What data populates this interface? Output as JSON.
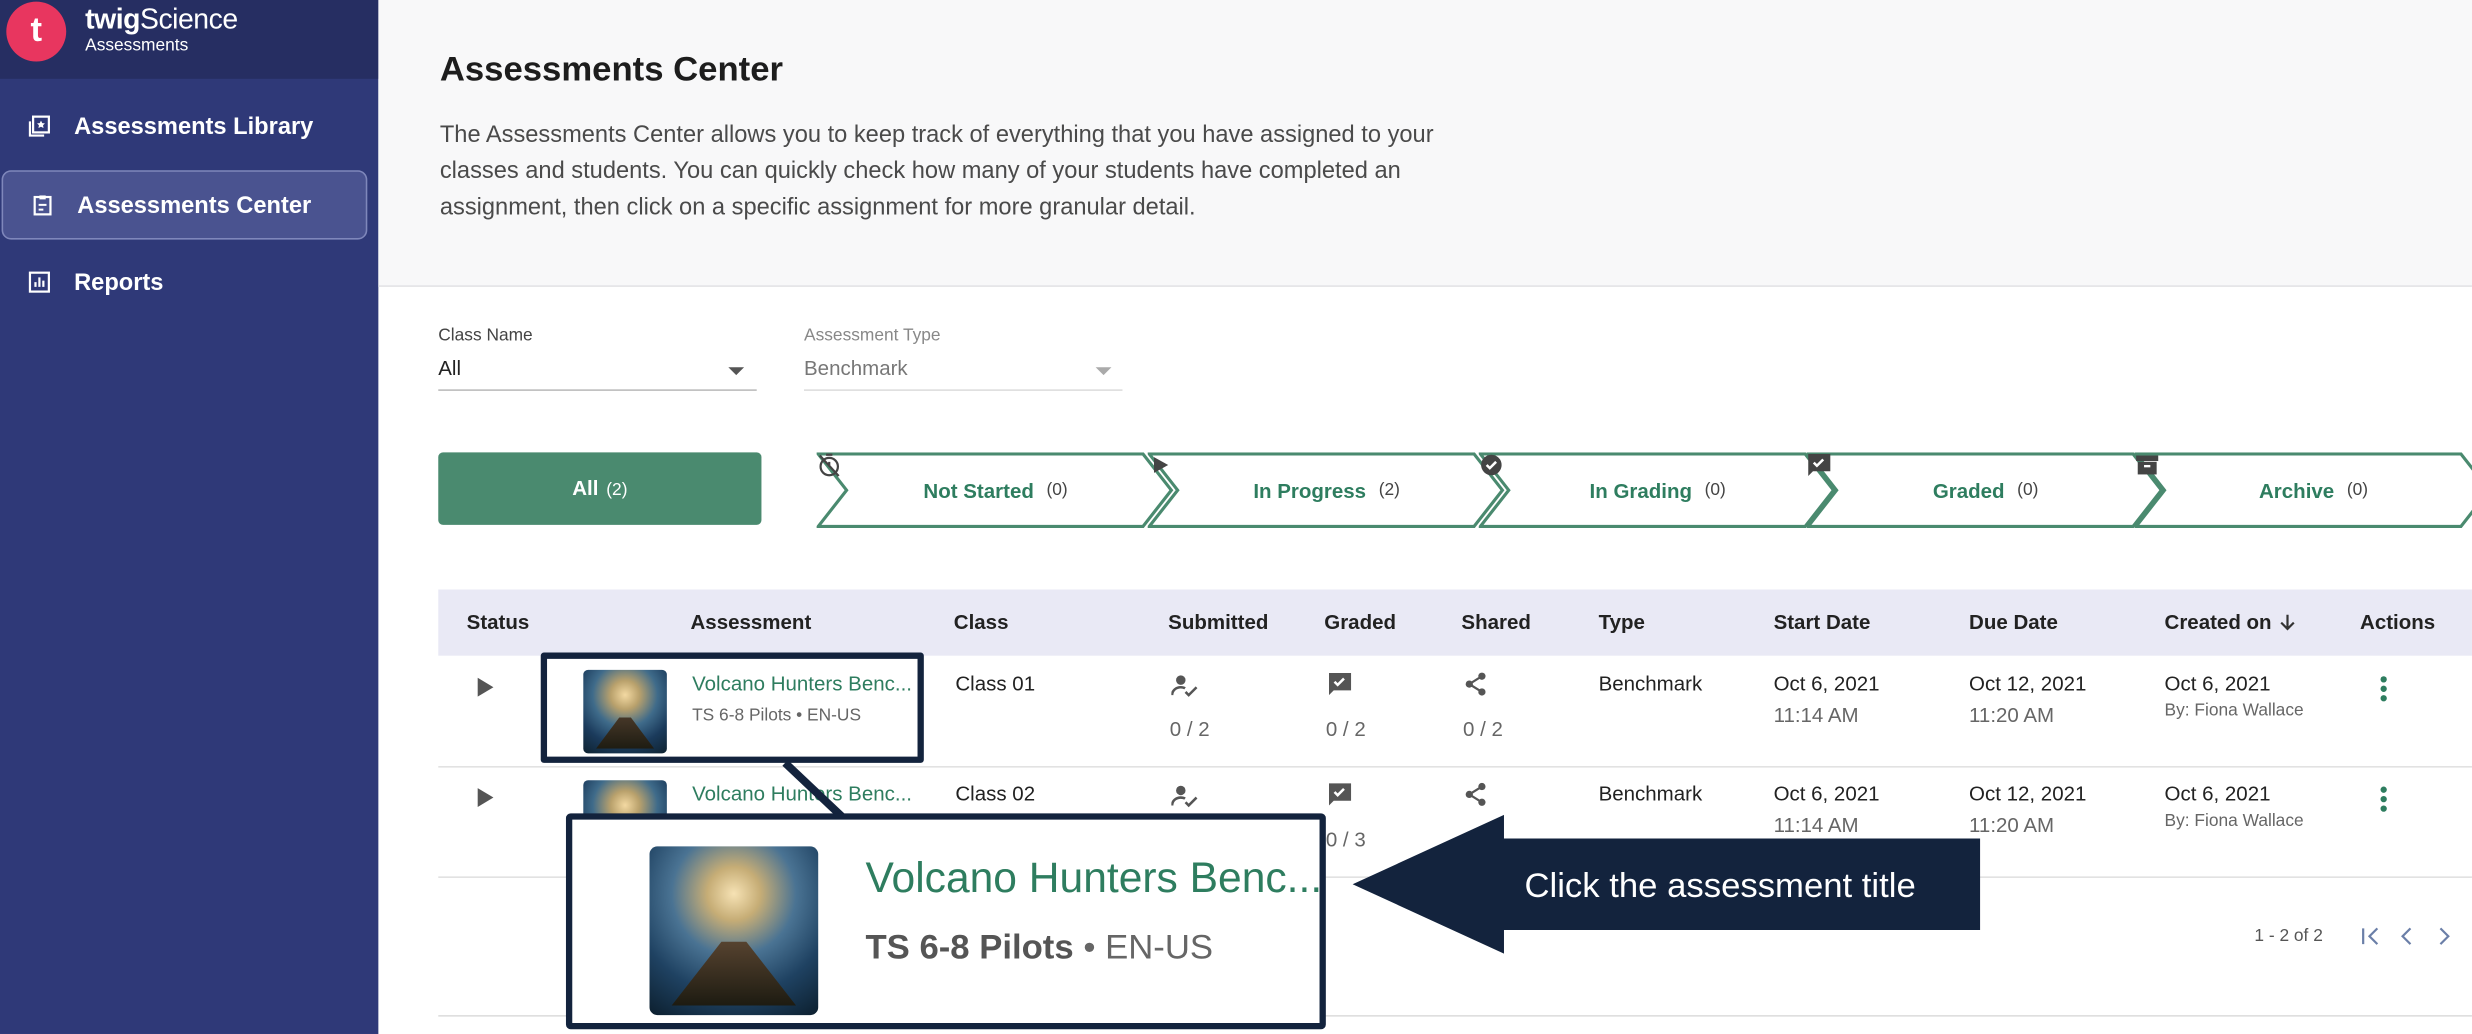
{
  "brand": {
    "logo_letter": "t",
    "name_bold": "twig",
    "name_rest": "Science",
    "subtitle": "Assessments"
  },
  "sidebar": {
    "items": [
      {
        "label": "Assessments Library",
        "icon": "library-icon",
        "active": false
      },
      {
        "label": "Assessments Center",
        "icon": "clipboard-icon",
        "active": true
      },
      {
        "label": "Reports",
        "icon": "chart-icon",
        "active": false
      }
    ]
  },
  "header": {
    "title": "Assessments Center",
    "description": "The Assessments Center allows you to keep track of everything that you have assigned to your classes and students. You can quickly check how many of your students have completed an assignment, then click on a specific assignment for more granular detail."
  },
  "filters": {
    "class_name": {
      "label": "Class Name",
      "value": "All"
    },
    "assessment_type": {
      "label": "Assessment Type",
      "value": "Benchmark"
    }
  },
  "status_tabs": [
    {
      "label": "All",
      "count": "(2)",
      "icon": ""
    },
    {
      "label": "Not Started",
      "count": "(0)",
      "icon": "timer-off-icon"
    },
    {
      "label": "In Progress",
      "count": "(2)",
      "icon": "play-icon"
    },
    {
      "label": "In Grading",
      "count": "(0)",
      "icon": "grading-icon"
    },
    {
      "label": "Graded",
      "count": "(0)",
      "icon": "graded-icon"
    },
    {
      "label": "Archive",
      "count": "(0)",
      "icon": "archive-icon"
    }
  ],
  "table": {
    "headers": [
      "Status",
      "Assessment",
      "Class",
      "Submitted",
      "Graded",
      "Shared",
      "Type",
      "Start Date",
      "Due Date",
      "Created on",
      "Actions"
    ],
    "rows": [
      {
        "title": "Volcano Hunters Benc...",
        "meta": "TS 6-8 Pilots • EN-US",
        "class": "Class 01",
        "submitted": "0 / 2",
        "graded": "0 / 2",
        "shared": "0 / 2",
        "type": "Benchmark",
        "start_date": "Oct 6, 2021",
        "start_time": "11:14 AM",
        "due_date": "Oct 12, 2021",
        "due_time": "11:20 AM",
        "created_date": "Oct 6, 2021",
        "created_by": "By: Fiona Wallace"
      },
      {
        "title": "Volcano Hunters Benc...",
        "meta": "",
        "class": "Class 02",
        "submitted": "",
        "graded": "0 / 3",
        "shared": "",
        "type": "Benchmark",
        "start_date": "Oct 6, 2021",
        "start_time": "11:14 AM",
        "due_date": "Oct 12, 2021",
        "due_time": "11:20 AM",
        "created_date": "Oct 6, 2021",
        "created_by": "By: Fiona Wallace"
      }
    ]
  },
  "pagination": {
    "summary": "1 - 2 of 2"
  },
  "callout": {
    "zoom_title": "Volcano Hunters Benc...",
    "zoom_meta_bold": "TS 6-8 Pilots",
    "zoom_meta_rest": "• EN-US",
    "instruction": "Click the assessment title"
  },
  "colors": {
    "sidebar": "#2f3978",
    "accent_green": "#4a8a6f",
    "brand_pink": "#e8365f",
    "callout_navy": "#13233d"
  }
}
